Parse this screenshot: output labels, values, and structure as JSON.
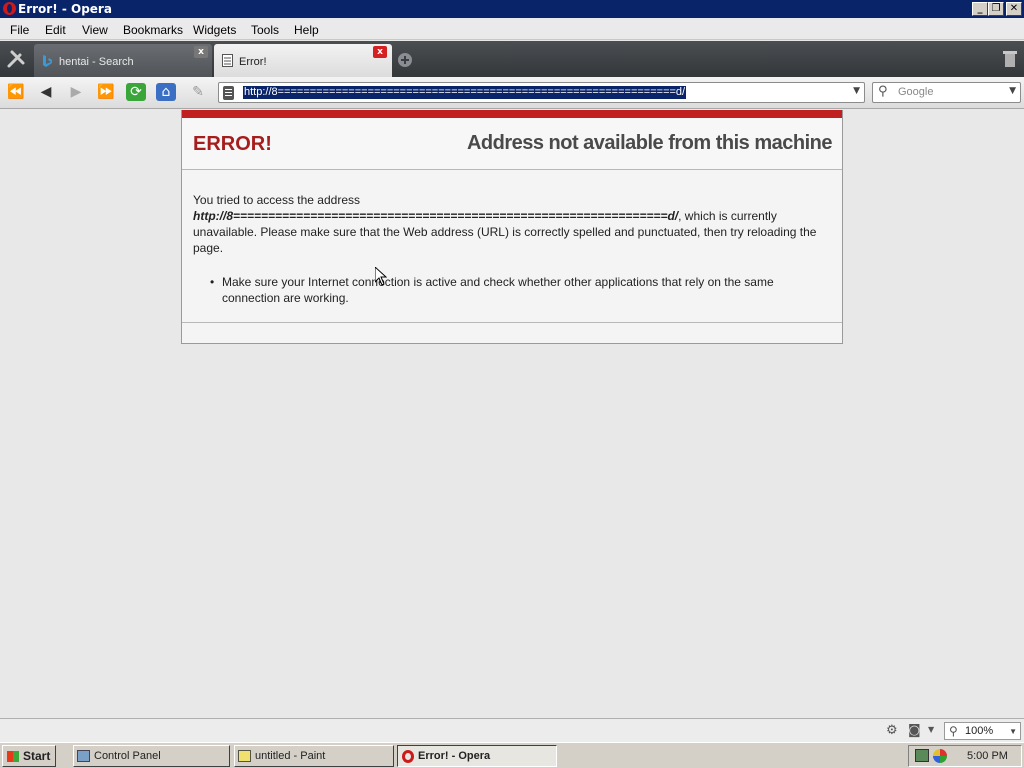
{
  "window": {
    "title": "Error! - Opera",
    "minimize_glyph": "_",
    "restore_glyph": "❐",
    "close_glyph": "✕"
  },
  "menu": {
    "items": [
      "File",
      "Edit",
      "View",
      "Bookmarks",
      "Widgets",
      "Tools",
      "Help"
    ]
  },
  "tabs": [
    {
      "label": "hentai - Search",
      "icon": "bing-icon",
      "active": false
    },
    {
      "label": "Error!",
      "icon": "page-icon",
      "active": true
    }
  ],
  "toolbar": {
    "address": "http://8==============================================================d/",
    "search_placeholder": "Google"
  },
  "page": {
    "error_word": "ERROR!",
    "error_title": "Address not available from this machine",
    "intro": "You tried to access the address",
    "url": "http://8==============================================================d/",
    "after_url": ", which is currently unavailable. Please make sure that the Web address (URL) is correctly spelled and punctuated, then try reloading the page.",
    "bullet": "Make sure your Internet connection is active and check whether other applications that rely on the same connection are working."
  },
  "statusbar": {
    "zoom": "100%"
  },
  "taskbar": {
    "start_label": "Start",
    "tasks": [
      {
        "label": "Control Panel",
        "active": false
      },
      {
        "label": "untitled - Paint",
        "active": false
      },
      {
        "label": "Error! - Opera",
        "active": true
      }
    ],
    "clock": "5:00 PM"
  },
  "colors": {
    "error_red": "#a51d1d",
    "titlebar": "#0a246a",
    "selection": "#0a246a"
  }
}
